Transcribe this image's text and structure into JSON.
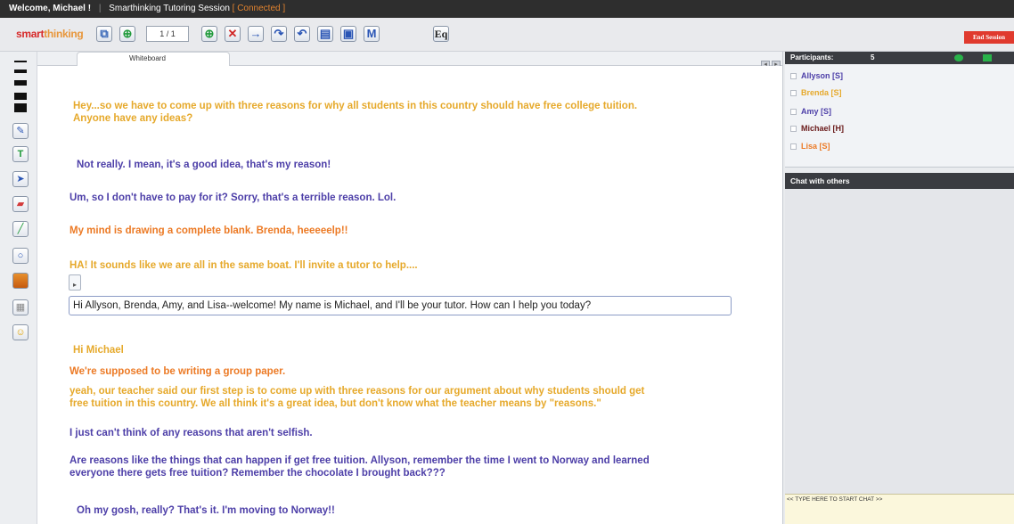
{
  "topbar": {
    "welcome": "Welcome, Michael !",
    "title": "Smarthinking Tutoring Session",
    "status": "[ Connected ]"
  },
  "toolbar": {
    "logo_a": "smart",
    "logo_b": "thinking",
    "page_counter": "1 / 1",
    "end_session_label": "End Session",
    "equation_label": "Eq",
    "m_label": "M"
  },
  "tabs": {
    "whiteboard_label": "Whiteboard"
  },
  "colors": {
    "gold": "#e6a92b",
    "purple": "#4d3fa8",
    "orange": "#ec7a25",
    "end_session": "#e03a2e"
  },
  "whiteboard": {
    "messages": [
      "Hey...so we have to come up with three reasons for why all students in this country should have free college tuition.",
      "Anyone have any ideas?",
      "Not really.  I mean, it's a good idea, that's my reason!",
      "Um, so I don't have to pay for it? Sorry, that's a terrible reason. Lol.",
      "My mind is drawing a complete blank. Brenda, heeeeelp!!",
      "HA! It sounds like we are all in the same boat.  I'll invite a tutor to help....",
      "Hi Michael",
      "We're supposed to be writing a group paper.",
      "yeah, our teacher said our first step is to come up with three reasons for our argument about why students should get",
      "free tuition in this country.  We all think it's a great idea, but don't know what the teacher means by \"reasons.\"",
      "I just can't think of any reasons that aren't selfish.",
      "Are reasons like the things that can happen if get free tuition.  Allyson, remember the time I went to Norway and learned",
      "everyone there gets free tuition?  Remember the chocolate I brought back???",
      "Oh my gosh, really? That's it. I'm moving to Norway!!"
    ],
    "tutor_input_value": "Hi Allyson, Brenda, Amy, and Lisa--welcome!  My name is Michael, and I'll be your tutor.  How can I help you today?"
  },
  "participants": {
    "header": "Participants:",
    "count": "5",
    "items": [
      {
        "label": "Allyson [S]"
      },
      {
        "label": "Brenda [S]"
      },
      {
        "label": "Amy [S]"
      },
      {
        "label": "Michael [H]"
      },
      {
        "label": "Lisa [S]"
      }
    ]
  },
  "chat": {
    "header": "Chat with others",
    "input_placeholder": "<< TYPE HERE TO START CHAT >>"
  }
}
